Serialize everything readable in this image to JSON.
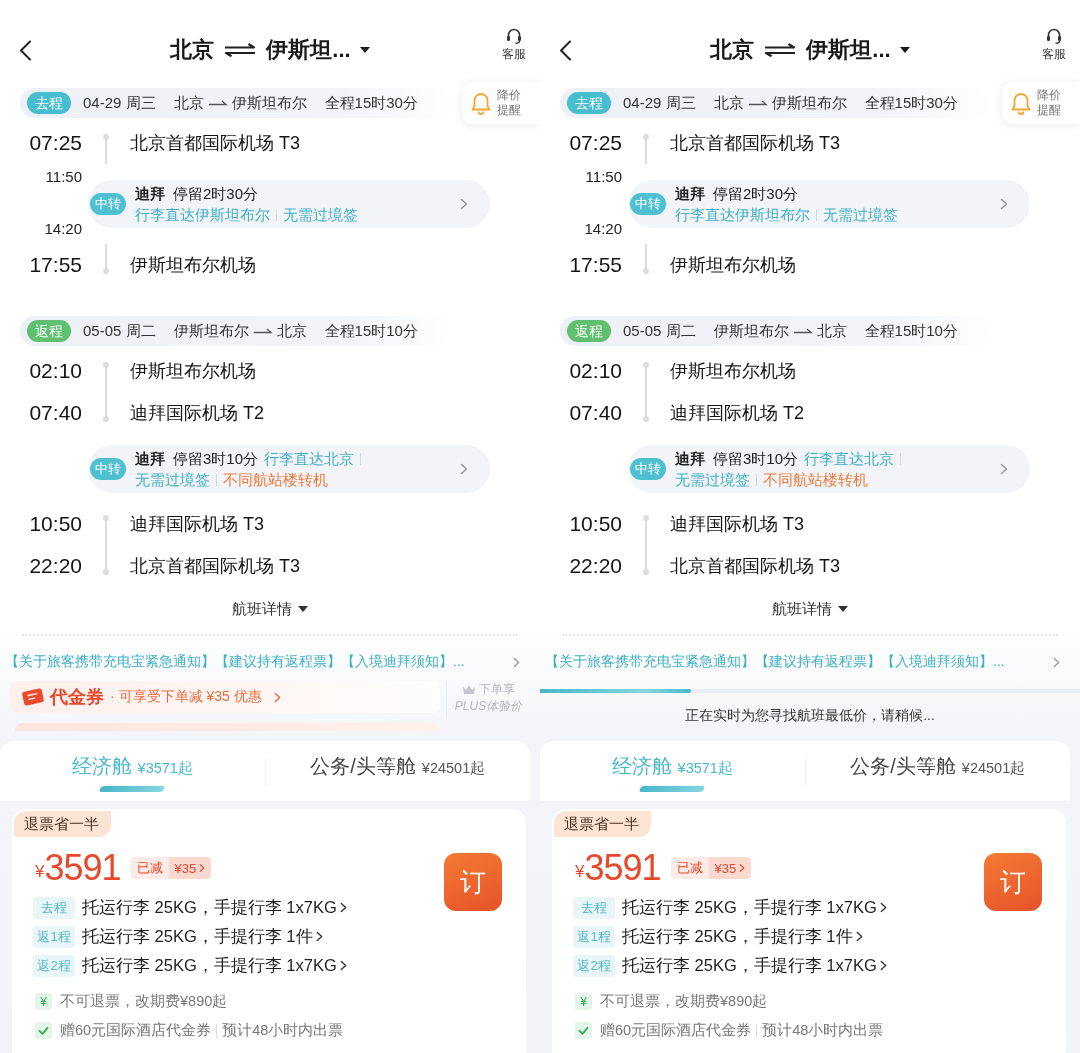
{
  "screens": [
    {
      "header": {
        "origin": "北京",
        "destination": "伊斯坦...",
        "service": "客服"
      },
      "legs": [
        {
          "kind": "outbound",
          "badge": "去程",
          "date": "04-29 周三",
          "from": "北京",
          "to": "伊斯坦布尔",
          "duration": "全程15时30分",
          "price_alert": "降价提醒",
          "timeline": [
            {
              "kind": "stop",
              "time": "07:25",
              "place": "北京首都国际机场 T3"
            },
            {
              "kind": "transfer",
              "arrive": "11:50",
              "depart": "14:20",
              "badge": "中转",
              "city": "迪拜",
              "stay": "停留2时30分",
              "notes": [
                {
                  "text": "行李直达伊斯坦布尔",
                  "color": "#3fb0c6"
                },
                {
                  "text": "无需过境签",
                  "color": "#3fb0c6"
                }
              ]
            },
            {
              "kind": "stop",
              "time": "17:55",
              "place": "伊斯坦布尔机场"
            }
          ]
        },
        {
          "kind": "return",
          "badge": "返程",
          "date": "05-05 周二",
          "from": "伊斯坦布尔",
          "to": "北京",
          "duration": "全程15时10分",
          "timeline": [
            {
              "kind": "stop",
              "time": "02:10",
              "place": "伊斯坦布尔机场"
            },
            {
              "kind": "stop",
              "time": "07:40",
              "place": "迪拜国际机场 T2"
            },
            {
              "kind": "transfer",
              "badge": "中转",
              "city": "迪拜",
              "stay": "停留3时10分",
              "notes": [
                {
                  "text": "行李直达北京",
                  "color": "#3fb0c6"
                },
                {
                  "text": "无需过境签",
                  "color": "#3fb0c6"
                },
                {
                  "text": "不同航站楼转机",
                  "color": "#f07a3c"
                }
              ]
            },
            {
              "kind": "stop",
              "time": "10:50",
              "place": "迪拜国际机场 T3"
            },
            {
              "kind": "stop",
              "time": "22:20",
              "place": "北京首都国际机场 T3"
            }
          ]
        }
      ],
      "details_toggle": "航班详情",
      "notice": "【关于旅客携带充电宝紧急通知】【建议持有返程票】【入境迪拜须知】...",
      "promo": {
        "kind": "voucher",
        "title": "代金券",
        "text": "· 可享受下单减 ¥35 优惠",
        "side_text": "下单享",
        "side_note": "PLUS体验价"
      },
      "cabins": [
        {
          "name": "经济舱",
          "price": "¥3571起",
          "selected": true
        },
        {
          "name": "公务/头等舱",
          "price": "¥24501起",
          "selected": false
        }
      ],
      "fare": {
        "tag": "退票省一半",
        "currency": "¥",
        "price": "3591",
        "discount_label": "已减",
        "discount_amount": "¥35",
        "book": "订",
        "baggage": [
          {
            "tag": "去程",
            "text": "托运行李 25KG，手提行李 1x7KG"
          },
          {
            "tag": "返1程",
            "text": "托运行李 25KG，手提行李 1件"
          },
          {
            "tag": "返2程",
            "text": "托运行李 25KG，手提行李 1x7KG"
          }
        ],
        "policies": [
          {
            "kind": "fee",
            "icon": "¥",
            "texts": [
              "不可退票，改期费¥890起"
            ]
          },
          {
            "kind": "perk",
            "texts": [
              "赠60元国际酒店代金券",
              "预计48小时内出票"
            ]
          }
        ]
      }
    },
    {
      "header": {
        "origin": "北京",
        "destination": "伊斯坦...",
        "service": "客服"
      },
      "legs": [
        {
          "kind": "outbound",
          "badge": "去程",
          "date": "04-29 周三",
          "from": "北京",
          "to": "伊斯坦布尔",
          "duration": "全程15时30分",
          "price_alert": "降价提醒",
          "timeline": [
            {
              "kind": "stop",
              "time": "07:25",
              "place": "北京首都国际机场 T3"
            },
            {
              "kind": "transfer",
              "arrive": "11:50",
              "depart": "14:20",
              "badge": "中转",
              "city": "迪拜",
              "stay": "停留2时30分",
              "notes": [
                {
                  "text": "行李直达伊斯坦布尔",
                  "color": "#3fb0c6"
                },
                {
                  "text": "无需过境签",
                  "color": "#3fb0c6"
                }
              ]
            },
            {
              "kind": "stop",
              "time": "17:55",
              "place": "伊斯坦布尔机场"
            }
          ]
        },
        {
          "kind": "return",
          "badge": "返程",
          "date": "05-05 周二",
          "from": "伊斯坦布尔",
          "to": "北京",
          "duration": "全程15时10分",
          "timeline": [
            {
              "kind": "stop",
              "time": "02:10",
              "place": "伊斯坦布尔机场"
            },
            {
              "kind": "stop",
              "time": "07:40",
              "place": "迪拜国际机场 T2"
            },
            {
              "kind": "transfer",
              "badge": "中转",
              "city": "迪拜",
              "stay": "停留3时10分",
              "notes": [
                {
                  "text": "行李直达北京",
                  "color": "#3fb0c6"
                },
                {
                  "text": "无需过境签",
                  "color": "#3fb0c6"
                },
                {
                  "text": "不同航站楼转机",
                  "color": "#f07a3c"
                }
              ]
            },
            {
              "kind": "stop",
              "time": "10:50",
              "place": "迪拜国际机场 T3"
            },
            {
              "kind": "stop",
              "time": "22:20",
              "place": "北京首都国际机场 T3"
            }
          ]
        }
      ],
      "details_toggle": "航班详情",
      "notice": "【关于旅客携带充电宝紧急通知】【建议持有返程票】【入境迪拜须知】...",
      "promo": {
        "kind": "loading",
        "level": 0.28,
        "text": "正在实时为您寻找航班最低价，请稍候..."
      },
      "cabins": [
        {
          "name": "经济舱",
          "price": "¥3571起",
          "selected": true
        },
        {
          "name": "公务/头等舱",
          "price": "¥24501起",
          "selected": false
        }
      ],
      "fare": {
        "tag": "退票省一半",
        "currency": "¥",
        "price": "3591",
        "discount_label": "已减",
        "discount_amount": "¥35",
        "book": "订",
        "baggage": [
          {
            "tag": "去程",
            "text": "托运行李 25KG，手提行李 1x7KG"
          },
          {
            "tag": "返1程",
            "text": "托运行李 25KG，手提行李 1件"
          },
          {
            "tag": "返2程",
            "text": "托运行李 25KG，手提行李 1x7KG"
          }
        ],
        "policies": [
          {
            "kind": "fee",
            "icon": "¥",
            "texts": [
              "不可退票，改期费¥890起"
            ]
          },
          {
            "kind": "perk",
            "texts": [
              "赠60元国际酒店代金券",
              "预计48小时内出票"
            ]
          }
        ]
      }
    }
  ]
}
